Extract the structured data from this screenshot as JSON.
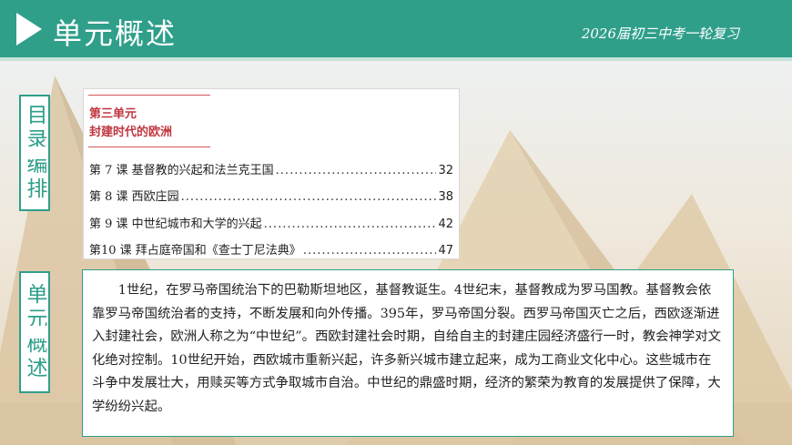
{
  "header": {
    "title": "单元概述",
    "subtitle": "2026届初三中考一轮复习"
  },
  "side_labels": {
    "toc": "目录编排",
    "summary": "单元概述"
  },
  "toc": {
    "unit": "第三单元",
    "unit_title": "封建时代的欧洲",
    "lessons": [
      {
        "lesson": "第 7 课  基督教的兴起和法兰克王国",
        "page": "32"
      },
      {
        "lesson": "第 8 课  西欧庄园",
        "page": "38"
      },
      {
        "lesson": "第 9 课  中世纪城市和大学的兴起",
        "page": "42"
      },
      {
        "lesson": "第10 课  拜占庭帝国和《查士丁尼法典》",
        "page": "47"
      }
    ]
  },
  "summary": {
    "text": "1世纪，在罗马帝国统治下的巴勒斯坦地区，基督教诞生。4世纪末，基督教成为罗马国教。基督教会依靠罗马帝国统治者的支持，不断发展和向外传播。395年，罗马帝国分裂。西罗马帝国灭亡之后，西欧逐渐进入封建社会，欧洲人称之为“中世纪”。西欧封建社会时期，自给自主的封建庄园经济盛行一时，教会神学对文化绝对控制。10世纪开始，西欧城市重新兴起，许多新兴城市建立起来，成为工商业文化中心。这些城市在斗争中发展壮大，用赎买等方式争取城市自治。中世纪的鼎盛时期，经济的繁荣为教育的发展提供了保障，大学纷纷兴起。"
  },
  "colors": {
    "accent": "#2f9f8a",
    "unit_red": "#c0353f"
  }
}
